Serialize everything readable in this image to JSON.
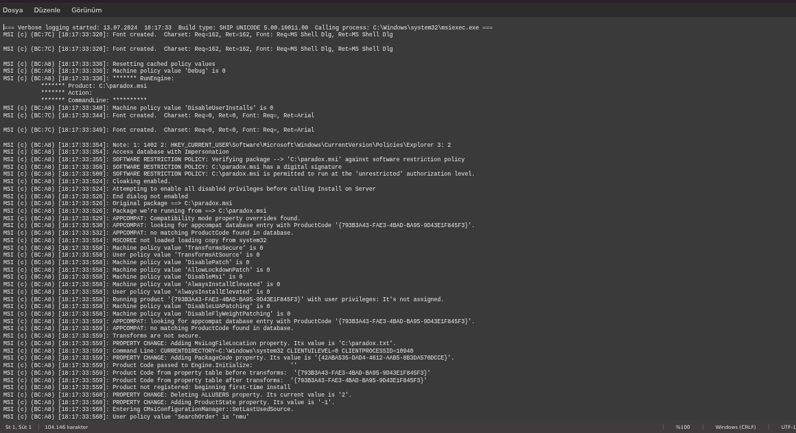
{
  "menu": [
    "Dosya",
    "Düzenle",
    "Görünüm"
  ],
  "editor": {
    "paragraphs": [
      [
        "=== Verbose logging started: 13.07.2024  18:17:33  Build type: SHIP UNICODE 5.00.10011.00  Calling process: C:\\Windows\\system32\\msiexec.exe ===",
        "MSI (c) (BC:7C) [18:17:33:320]: Font created.  Charset: Req=162, Ret=162, Font: Req=MS Shell Dlg, Ret=MS Shell Dlg"
      ],
      [
        "MSI (c) (BC:7C) [18:17:33:320]: Font created.  Charset: Req=162, Ret=162, Font: Req=MS Shell Dlg, Ret=MS Shell Dlg"
      ],
      [
        "MSI (c) (BC:A8) [18:17:33:336]: Resetting cached policy values",
        "MSI (c) (BC:A8) [18:17:33:336]: Machine policy value 'Debug' is 0",
        "MSI (c) (BC:A8) [18:17:33:336]: ******* RunEngine:",
        "           ******* Product: C:\\paradox.msi",
        "           ******* Action: ",
        "           ******* CommandLine: **********",
        "MSI (c) (BC:A8) [18:17:33:340]: Machine policy value 'DisableUserInstalls' is 0",
        "MSI (c) (BC:7C) [18:17:33:344]: Font created.  Charset: Req=0, Ret=0, Font: Req=, Ret=Arial"
      ],
      [
        "MSI (c) (BC:7C) [18:17:33:349]: Font created.  Charset: Req=0, Ret=0, Font: Req=, Ret=Arial"
      ],
      [
        "MSI (c) (BC:A8) [18:17:33:354]: Note: 1: 1402 2: HKEY_CURRENT_USER\\Software\\Microsoft\\Windows\\CurrentVersion\\Policies\\Explorer 3: 2",
        "MSI (c) (BC:A8) [18:17:33:354]: Access database with Impersonation",
        "MSI (c) (BC:A8) [18:17:33:355]: SOFTWARE RESTRICTION POLICY: Verifying package --> 'C:\\paradox.msi' against software restriction policy",
        "MSI (c) (BC:A8) [18:17:33:356]: SOFTWARE RESTRICTION POLICY: C:\\paradox.msi has a digital signature",
        "MSI (c) (BC:A8) [18:17:33:500]: SOFTWARE RESTRICTION POLICY: C:\\paradox.msi is permitted to run at the 'unrestricted' authorization level.",
        "MSI (c) (BC:A8) [18:17:33:524]: Cloaking enabled.",
        "MSI (c) (BC:A8) [18:17:33:524]: Attempting to enable all disabled privileges before calling Install on Server",
        "MSI (c) (BC:A8) [18:17:33:526]: End dialog not enabled",
        "MSI (c) (BC:A8) [18:17:33:526]: Original package ==> C:\\paradox.msi",
        "MSI (c) (BC:A8) [18:17:33:526]: Package we're running from ==> C:\\paradox.msi",
        "MSI (c) (BC:A8) [18:17:33:529]: APPCOMPAT: Compatibility mode property overrides found.",
        "MSI (c) (BC:A8) [18:17:33:530]: APPCOMPAT: looking for appcompat database entry with ProductCode '{793B3A43-FAE3-4BAD-BA95-9D43E1F845F3}'.",
        "MSI (c) (BC:A8) [18:17:33:532]: APPCOMPAT: no matching ProductCode found in database.",
        "MSI (c) (BC:A8) [18:17:33:554]: MSCOREE not loaded loading copy from system32",
        "MSI (c) (BC:A8) [18:17:33:558]: Machine policy value 'TransformsSecure' is 0",
        "MSI (c) (BC:A8) [18:17:33:558]: User policy value 'TransformsAtSource' is 0",
        "MSI (c) (BC:A8) [18:17:33:558]: Machine policy value 'DisablePatch' is 0",
        "MSI (c) (BC:A8) [18:17:33:558]: Machine policy value 'AllowLockdownPatch' is 0",
        "MSI (c) (BC:A8) [18:17:33:558]: Machine policy value 'DisableMsi' is 0",
        "MSI (c) (BC:A8) [18:17:33:558]: Machine policy value 'AlwaysInstallElevated' is 0",
        "MSI (c) (BC:A8) [18:17:33:558]: User policy value 'AlwaysInstallElevated' is 0",
        "MSI (c) (BC:A8) [18:17:33:558]: Running product '{793B3A43-FAE3-4BAD-BA95-9D43E1F845F3}' with user privileges: It's not assigned.",
        "MSI (c) (BC:A8) [18:17:33:558]: Machine policy value 'DisableLUAPatching' is 0",
        "MSI (c) (BC:A8) [18:17:33:558]: Machine policy value 'DisableFlyWeightPatching' is 0",
        "MSI (c) (BC:A8) [18:17:33:559]: APPCOMPAT: looking for appcompat database entry with ProductCode '{793B3A43-FAE3-4BAD-BA95-9D43E1F845F3}'.",
        "MSI (c) (BC:A8) [18:17:33:559]: APPCOMPAT: no matching ProductCode found in database.",
        "MSI (c) (BC:A8) [18:17:33:559]: Transforms are not secure.",
        "MSI (c) (BC:A8) [18:17:33:559]: PROPERTY CHANGE: Adding MsiLogFileLocation property. Its value is 'C:\\paradox.txt'.",
        "MSI (c) (BC:A8) [18:17:33:559]: Command Line: CURRENTDIRECTORY=C:\\Windows\\system32 CLIENTUILEVEL=0 CLIENTPROCESSID=10940",
        "MSI (c) (BC:A8) [18:17:33:559]: PROPERTY CHANGE: Adding PackageCode property. Its value is '{42ABA535-DAD4-4612-AAB5-8B3DA570DCCE}'.",
        "MSI (c) (BC:A8) [18:17:33:559]: Product Code passed to Engine.Initialize:           ''",
        "MSI (c) (BC:A8) [18:17:33:559]: Product Code from property table before transforms:  '{793B3A43-FAE3-4BAD-BA95-9D43E1F845F3}'",
        "MSI (c) (BC:A8) [18:17:33:559]: Product Code from property table after transforms:  '{793B3A43-FAE3-4BAD-BA95-9D43E1F845F3}'",
        "MSI (c) (BC:A8) [18:17:33:559]: Product not registered: beginning first-time install",
        "MSI (c) (BC:A8) [18:17:33:560]: PROPERTY CHANGE: Deleting ALLUSERS property. Its current value is '2'.",
        "MSI (c) (BC:A8) [18:17:33:560]: PROPERTY CHANGE: Adding ProductState property. Its value is '-1'.",
        "MSI (c) (BC:A8) [18:17:33:560]: Entering CMsiConfigurationManager::SetLastUsedSource.",
        "MSI (c) (BC:A8) [18:17:33:560]: User policy value 'SearchOrder' is 'nmu'"
      ]
    ]
  },
  "status_bar": {
    "left": [
      "St 1, Süt 1",
      "104.146 karakter"
    ],
    "right": [
      "%100",
      "Windows (CRLF)",
      "UTF-1"
    ]
  }
}
